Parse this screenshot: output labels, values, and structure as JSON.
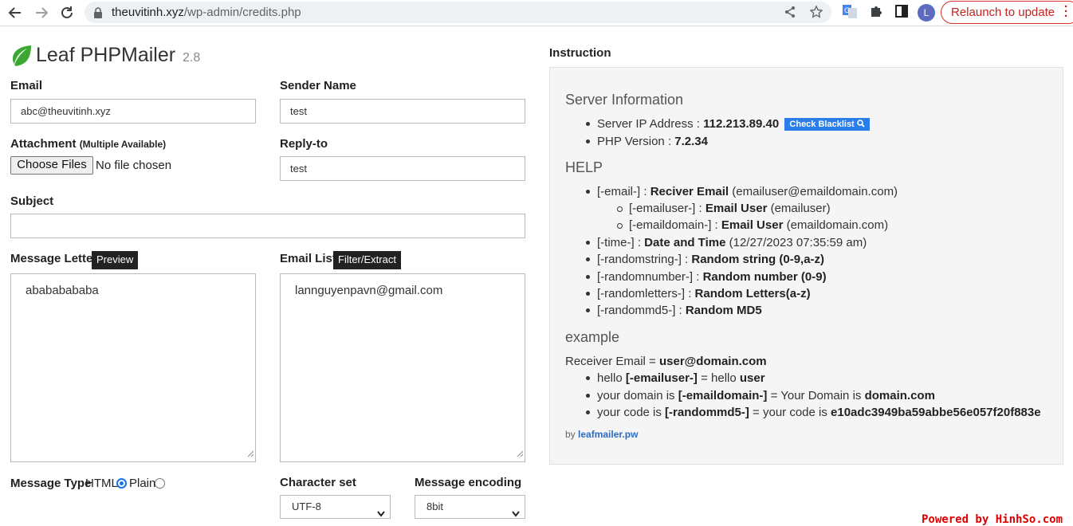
{
  "browser": {
    "url_host": "theuvitinh.xyz",
    "url_path": "/wp-admin/credits.php",
    "profile_initial": "L",
    "relaunch_label": "Relaunch to update"
  },
  "app": {
    "logo_name": "Leaf PHPMailer",
    "logo_version": "2.8"
  },
  "form": {
    "email_label": "Email",
    "email_value": "abc@theuvitinh.xyz",
    "sender_name_label": "Sender Name",
    "sender_name_value": "test",
    "attachment_label": "Attachment",
    "attachment_sub": "(Multiple Available)",
    "choose_files_label": "Choose Files",
    "no_file_label": "No file chosen",
    "reply_to_label": "Reply-to",
    "reply_to_value": "test",
    "subject_label": "Subject",
    "subject_value": "",
    "message_letter_label": "Message Letter",
    "preview_label": "Preview",
    "message_value": "abababababa",
    "email_list_label": "Email List",
    "filter_label": "Filter/Extract",
    "email_list_value": "lannguyenpavn@gmail.com",
    "message_type_label": "Message Type",
    "html_label": "HTML",
    "plain_label": "Plain",
    "message_type_selected": "HTML",
    "charset_label": "Character set",
    "charset_value": "UTF-8",
    "encoding_label": "Message encoding",
    "encoding_value": "8bit"
  },
  "instruction": {
    "title": "Instruction",
    "server_heading": "Server Information",
    "server_ip_label": "Server IP Address :",
    "server_ip": "112.213.89.40",
    "blacklist_label": "Check Blacklist",
    "php_label": "PHP Version :",
    "php_version": "7.2.34",
    "help_heading": "HELP",
    "help_items": [
      {
        "tag": "[-email-] :",
        "name": "Reciver Email",
        "note": "(emailuser@emaildomain.com)"
      },
      {
        "tag": "[-emailuser-] :",
        "name": "Email User",
        "note": "(emailuser)"
      },
      {
        "tag": "[-emaildomain-] :",
        "name": "Email User",
        "note": "(emaildomain.com)"
      },
      {
        "tag": "[-time-] :",
        "name": "Date and Time",
        "note": "(12/27/2023 07:35:59 am)"
      },
      {
        "tag": "[-randomstring-] :",
        "name": "Random string (0-9,a-z)",
        "note": ""
      },
      {
        "tag": "[-randomnumber-] :",
        "name": "Random number (0-9)",
        "note": ""
      },
      {
        "tag": "[-randomletters-] :",
        "name": "Random Letters(a-z)",
        "note": ""
      },
      {
        "tag": "[-randommd5-] :",
        "name": "Random MD5",
        "note": ""
      }
    ],
    "example_heading": "example",
    "receiver_label": "Receiver Email =",
    "receiver_value": "user@domain.com",
    "examples": [
      {
        "a": "hello",
        "b": "[-emailuser-]",
        "c": "= hello",
        "d": "user"
      },
      {
        "a": "your domain is",
        "b": "[-emaildomain-]",
        "c": "= Your Domain is",
        "d": "domain.com"
      },
      {
        "a": "your code is",
        "b": "[-randommd5-]",
        "c": "= your code is",
        "d": "e10adc3949ba59abbe56e057f20f883e"
      }
    ],
    "by_label": "by",
    "by_link": "leafmailer.pw"
  },
  "watermark": "Powered by HinhSo.com",
  "colors": {
    "leaf_green": "#3aa832",
    "blacklist_blue": "#2b7de9",
    "relaunch_red": "#d93025",
    "watermark_red": "#e00000"
  }
}
